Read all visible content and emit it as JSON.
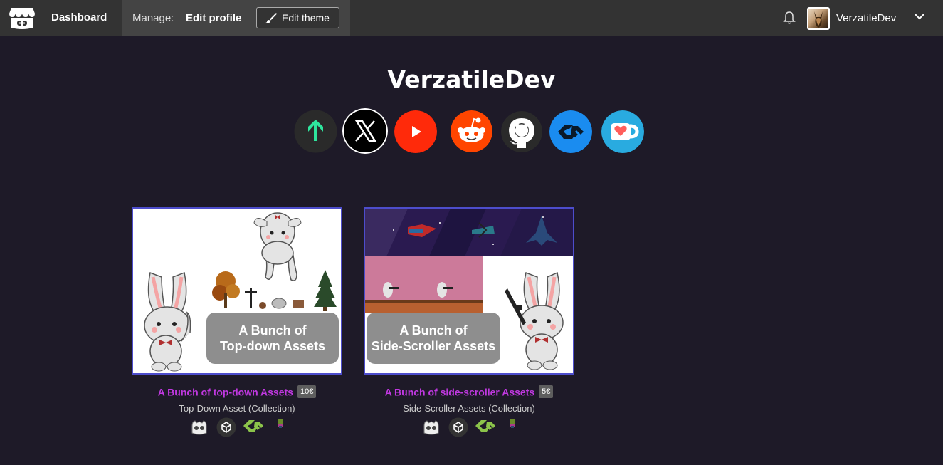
{
  "nav": {
    "logo_icon": "itchio-logo-icon",
    "dashboard_label": "Dashboard",
    "manage_label": "Manage:",
    "edit_profile_label": "Edit profile",
    "edit_theme_label": "Edit theme",
    "bell_icon": "bell-icon",
    "username": "VerzatileDev",
    "menu_icon": "chevron-down-icon"
  },
  "profile": {
    "title": "VerzatileDev",
    "socials": [
      {
        "name": "linktree-icon",
        "color": "#2a2a2a"
      },
      {
        "name": "x-twitter-icon",
        "color": "#000000"
      },
      {
        "name": "youtube-icon",
        "color": "#ff2a0a"
      },
      {
        "name": "reddit-icon",
        "color": "#ff4500"
      },
      {
        "name": "github-icon",
        "color": "#2a2a2a"
      },
      {
        "name": "gamemaker-icon",
        "color": "#1a8cf0"
      },
      {
        "name": "kofi-icon",
        "color": "#29abe0"
      }
    ]
  },
  "games": [
    {
      "title": "A Bunch of top-down Assets",
      "price": "10€",
      "subtitle": "Top-Down Asset (Collection)",
      "thumb_text_1": "A Bunch of",
      "thumb_text_2": "Top-down Assets",
      "engines": [
        "godot-icon",
        "unity-icon",
        "gamemaker-icon",
        "pico-icon"
      ]
    },
    {
      "title": "A Bunch of side-scroller Assets",
      "price": "5€",
      "subtitle": "Side-Scroller Assets (Collection)",
      "thumb_text_1": "A Bunch of",
      "thumb_text_2": "Side-Scroller Assets",
      "engines": [
        "godot-icon",
        "unity-icon",
        "gamemaker-icon",
        "pico-icon"
      ]
    }
  ],
  "colors": {
    "background": "#1e1a28",
    "topbar": "#333333",
    "link": "#c038e0",
    "thumb_border": "#4d4dcc"
  }
}
